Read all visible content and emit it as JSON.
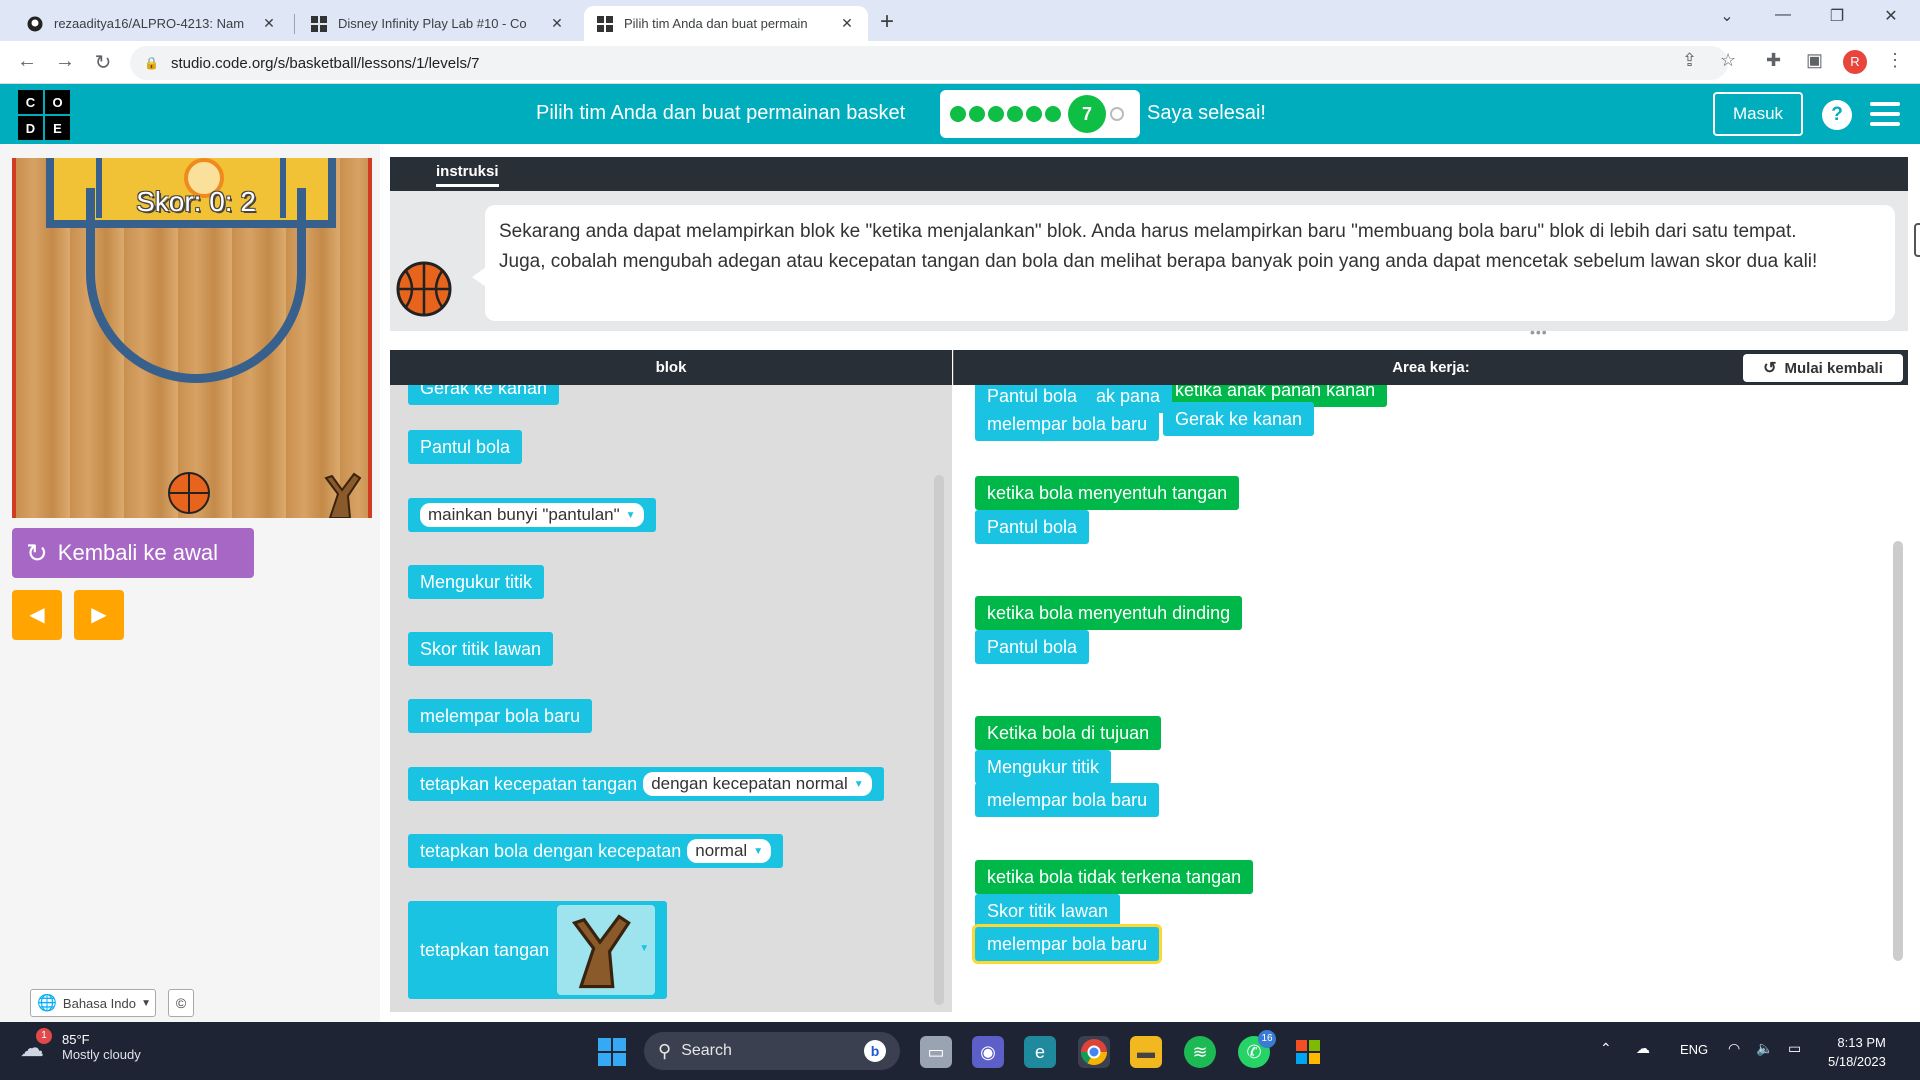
{
  "browser": {
    "tabs": [
      {
        "title": "rezaaditya16/ALPRO-4213: Nam",
        "icon": "github-icon"
      },
      {
        "title": "Disney Infinity Play Lab #10 - Co",
        "icon": "code-org-icon"
      },
      {
        "title": "Pilih tim Anda dan buat permain",
        "icon": "code-org-icon"
      }
    ],
    "url": "studio.code.org/s/basketball/lessons/1/levels/7",
    "profile_initial": "R"
  },
  "header": {
    "logo_letters": [
      "C",
      "O",
      "D",
      "E"
    ],
    "lesson_title": "Pilih tim Anda dan buat permainan basket",
    "current_level": "7",
    "completed_levels": 6,
    "done_label": "Saya selesai!",
    "login_label": "Masuk",
    "help_label": "?"
  },
  "game": {
    "score_text": "Skor: 0: 2",
    "reset_label": "Kembali ke awal",
    "prev_step": "◀",
    "next_step": "▶",
    "language": "Bahasa Indo",
    "copyright": "©"
  },
  "instructions": {
    "tab_label": "instruksi",
    "text": "Sekarang anda dapat melampirkan blok ke \"ketika menjalankan\" blok. Anda harus melampirkan baru \"membuang bola baru\" blok di lebih dari satu tempat. Juga, cobalah mengubah adegan atau kecepatan tangan dan bola dan melihat berapa banyak poin yang anda dapat mencetak sebelum lawan skor dua kali!"
  },
  "toolbox": {
    "header": "blok",
    "partial_top": "Gerak ke kanan",
    "blocks": [
      {
        "label": "Pantul bola"
      },
      {
        "label": "mainkan bunyi",
        "chip": "\"pantulan\""
      },
      {
        "label": "Mengukur titik"
      },
      {
        "label": "Skor titik lawan"
      },
      {
        "label": "melempar bola baru"
      },
      {
        "label": "tetapkan kecepatan tangan",
        "chip": "dengan kecepatan normal"
      },
      {
        "label": "tetapkan bola dengan kecepatan",
        "chip": "normal"
      },
      {
        "label": "tetapkan tangan"
      }
    ]
  },
  "workspace": {
    "header": "Area kerja:",
    "restart_label": "Mulai kembali",
    "top_partial": {
      "pantul": "Pantul bola",
      "anak_panah": "ak pana",
      "event": "ketika anak panah kanan",
      "lempar": "melempar bola baru",
      "gerak": "Gerak ke kanan"
    },
    "groups": [
      {
        "event": "ketika bola menyentuh tangan",
        "actions": [
          "Pantul bola"
        ]
      },
      {
        "event": "ketika bola menyentuh dinding",
        "actions": [
          "Pantul bola"
        ]
      },
      {
        "event": "Ketika bola di tujuan",
        "actions": [
          "Mengukur titik",
          "melempar bola baru"
        ]
      },
      {
        "event": "ketika bola tidak terkena tangan",
        "actions": [
          "Skor titik lawan",
          "melempar bola baru"
        ]
      }
    ]
  },
  "taskbar": {
    "weather_temp": "85°F",
    "weather_desc": "Mostly cloudy",
    "weather_badge": "1",
    "search_label": "Search",
    "whatsapp_badge": "16",
    "lang": "ENG",
    "time": "8:13 PM",
    "date": "5/18/2023"
  },
  "colors": {
    "brand_teal": "#00adbc",
    "block_cyan": "#19c3e1",
    "block_green": "#00b749",
    "progress_green": "#0fbe44",
    "reset_purple": "#a768c5",
    "step_orange": "#ffa400"
  }
}
